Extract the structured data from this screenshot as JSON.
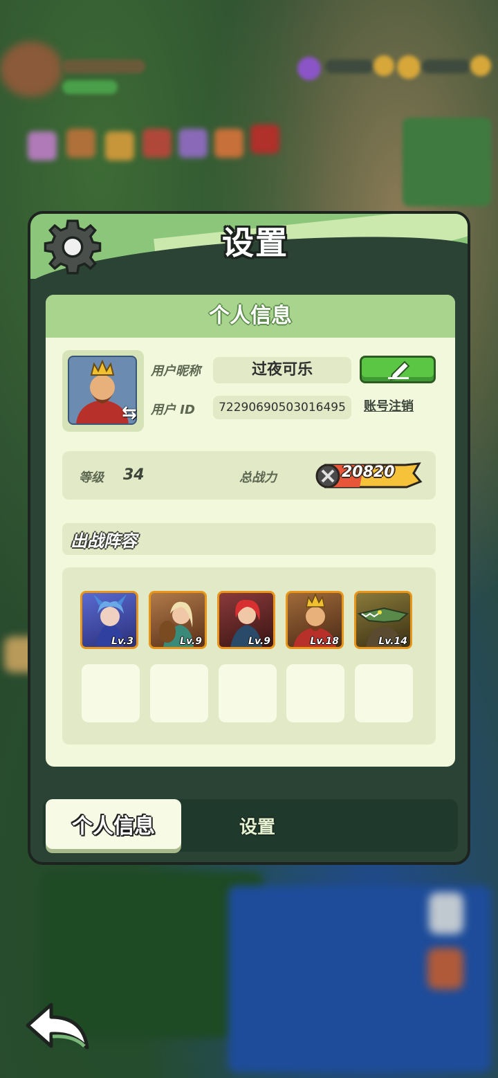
{
  "panel": {
    "title": "设置",
    "gear_icon": "gear-icon"
  },
  "profile": {
    "section_title": "个人信息",
    "nickname_label": "用户昵称",
    "nickname": "过夜可乐",
    "id_label": "用户 ID",
    "user_id": "7229069050301649​5",
    "edit_icon": "pencil-icon",
    "cancel_account_label": "账号注销"
  },
  "stats": {
    "level_label": "等级",
    "level_value": "34",
    "power_label": "总战力",
    "power_value": "20820"
  },
  "lineup": {
    "title": "出战阵容",
    "heroes": [
      {
        "level": "Lv.3",
        "color": "#3a4fb0"
      },
      {
        "level": "Lv.9",
        "color": "#7a4a2a"
      },
      {
        "level": "Lv.9",
        "color": "#5a2a2a"
      },
      {
        "level": "Lv.18",
        "color": "#6a3a22"
      },
      {
        "level": "Lv.14",
        "color": "#4a5a2a"
      }
    ],
    "empty_slots": 5
  },
  "tabs": {
    "active": "个人信息",
    "other": "设置"
  },
  "colors": {
    "accent_green": "#8cc67a",
    "edit_green": "#5bc544",
    "hero_border": "#e8961a"
  }
}
